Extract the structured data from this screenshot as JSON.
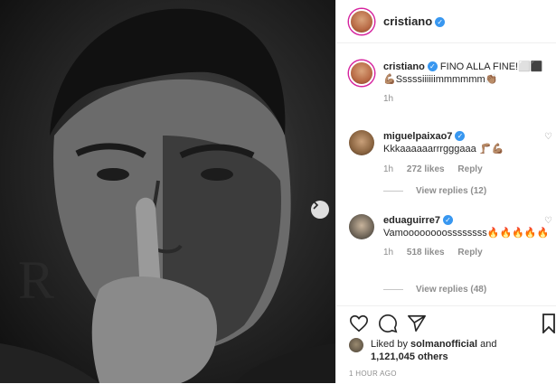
{
  "post": {
    "photo_alt": "Cristiano black and white photo with finger to lips"
  },
  "header": {
    "username": "cristiano"
  },
  "caption": {
    "username": "cristiano",
    "text_line1": "FINO ALLA FINE!⬜⬛",
    "text_line2": "💪🏽Sssssiiiiiimmmmmm👏🏽",
    "time": "1h"
  },
  "comments": [
    {
      "username": "miguelpaixao7",
      "text": "Kkkaaaaaarrrgggaaa 🦵🏽💪🏽",
      "time": "1h",
      "likes": "272 likes",
      "reply": "Reply",
      "view_replies": "View replies (12)"
    },
    {
      "username": "eduaguirre7",
      "text": "Vamoooooooossssssss🔥🔥🔥🔥🔥",
      "time": "1h",
      "likes": "518 likes",
      "reply": "Reply",
      "view_replies": "View replies (48)"
    }
  ],
  "likes": {
    "prefix": "Liked by",
    "user": "solmanofficial",
    "and": "and",
    "count": "1,121,045 others"
  },
  "timestamp": "1 HOUR AGO",
  "icons": {
    "heart": "heart-icon",
    "comment": "comment-icon",
    "share": "share-icon",
    "bookmark": "bookmark-icon",
    "verified": "verified-icon",
    "next": "chevron-right-icon"
  },
  "colors": {
    "verified": "#3897f0",
    "muted": "#8e8e8e",
    "text": "#262626"
  }
}
